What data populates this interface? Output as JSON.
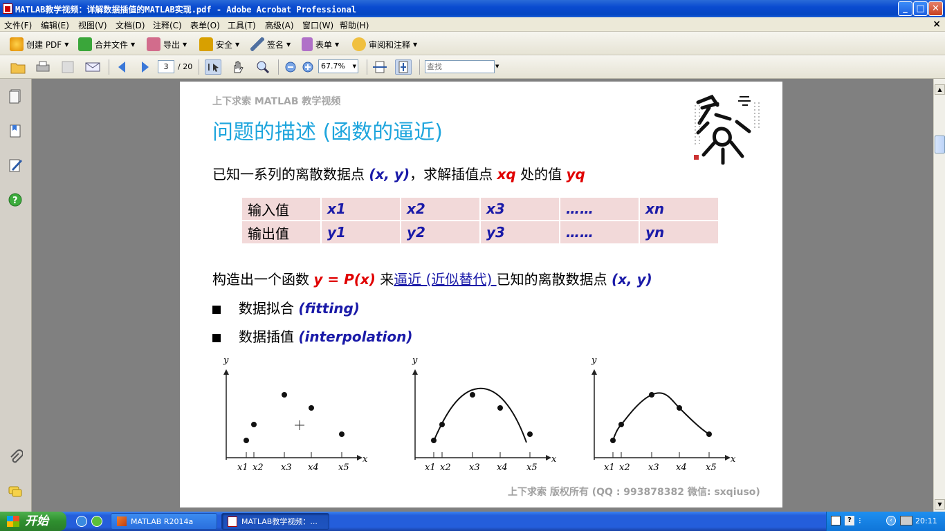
{
  "window": {
    "title": "MATLAB教学视频：详解数据插值的MATLAB实现.pdf - Adobe Acrobat Professional",
    "buttons": {
      "minimize": "_",
      "maximize": "□",
      "close": "✕"
    }
  },
  "menu": [
    "文件(F)",
    "编辑(E)",
    "视图(V)",
    "文档(D)",
    "注释(C)",
    "表单(O)",
    "工具(T)",
    "高级(A)",
    "窗口(W)",
    "帮助(H)"
  ],
  "toolbar1": [
    {
      "label": "创建 PDF",
      "icon": "create-pdf-icon"
    },
    {
      "label": "合并文件",
      "icon": "combine-files-icon"
    },
    {
      "label": "导出",
      "icon": "export-icon"
    },
    {
      "label": "安全",
      "icon": "lock-icon"
    },
    {
      "label": "签名",
      "icon": "pen-icon"
    },
    {
      "label": "表单",
      "icon": "form-icon"
    },
    {
      "label": "审阅和注释",
      "icon": "comment-icon"
    }
  ],
  "toolbar2": {
    "page_current": "3",
    "page_total": "/ 20",
    "zoom": "67.7%",
    "search_placeholder": "查找"
  },
  "document": {
    "header_small": "上下求索 MATLAB 教学视频",
    "title": "问题的描述 (函数的逼近)",
    "intro": {
      "p1": "已知一系列的离散数据点 ",
      "xy": "(x, y)",
      "p2": "，求解插值点 ",
      "xq": "xq",
      "p3": " 处的值 ",
      "yq": "yq"
    },
    "table": {
      "rows": [
        {
          "label": "输入值",
          "values": [
            "x1",
            "x2",
            "x3",
            "……",
            "xn"
          ]
        },
        {
          "label": "输出值",
          "values": [
            "y1",
            "y2",
            "y3",
            "……",
            "yn"
          ]
        }
      ]
    },
    "construct": {
      "p1": "构造出一个函数 ",
      "func": "y = P(x)",
      "p2": " 来",
      "link": "逼近 (近似替代) ",
      "p3": "已知的离散数据点 ",
      "xy": "(x, y)"
    },
    "bullets": [
      {
        "text": "数据拟合 ",
        "en": "(fitting)"
      },
      {
        "text": "数据插值 ",
        "en": "(interpolation)"
      }
    ],
    "plot_labels": {
      "y": "y",
      "x": "x",
      "ticks": [
        "x1",
        "x2",
        "x3",
        "x4",
        "x5"
      ]
    },
    "footer": "上下求索  版权所有  (QQ : 993878382   微信: sxqiuso)"
  },
  "taskbar": {
    "start": "开始",
    "tasks": [
      "MATLAB R2014a",
      "MATLAB教学视频：..."
    ],
    "clock": "20:11"
  }
}
